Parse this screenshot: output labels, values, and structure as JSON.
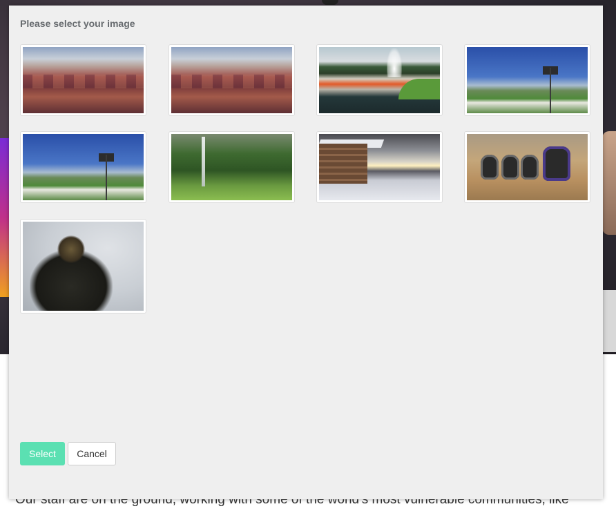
{
  "background": {
    "body_text": "Our staff are on the ground, working with some of the world's most vulnerable communities, like"
  },
  "modal": {
    "title": "Please select your image",
    "images": [
      {
        "subject": "canyon-icon"
      },
      {
        "subject": "canyon-icon"
      },
      {
        "subject": "geyser-icon"
      },
      {
        "subject": "mountains-icon"
      },
      {
        "subject": "mountains-icon"
      },
      {
        "subject": "waterfall-icon"
      },
      {
        "subject": "cabin-icon"
      },
      {
        "subject": "skulls-icon"
      },
      {
        "subject": "bird-icon"
      }
    ],
    "buttons": {
      "select_label": "Select",
      "cancel_label": "Cancel"
    }
  },
  "colors": {
    "accent": "#5be0b2",
    "modal_bg": "#efefef"
  }
}
